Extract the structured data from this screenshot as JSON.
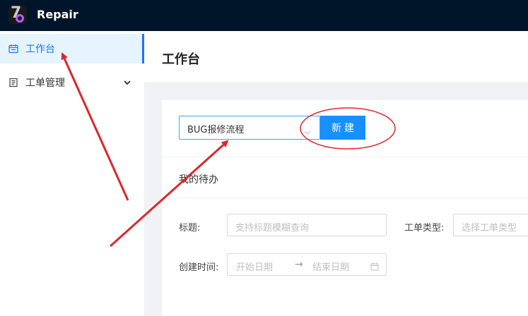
{
  "app": {
    "name": "Repair",
    "logo_icon": "app-logo-icon"
  },
  "sidebar": {
    "items": [
      {
        "label": "工作台",
        "icon": "calendar-icon",
        "active": true
      },
      {
        "label": "工单管理",
        "icon": "clipboard-icon",
        "expandable": true
      }
    ]
  },
  "header": {
    "title": "工作台"
  },
  "toolbar": {
    "process_select": {
      "value": "BUG报修流程"
    },
    "new_label": "新建"
  },
  "todo": {
    "title": "我的待办"
  },
  "filters": {
    "title_label": "标题:",
    "title_placeholder": "支持标题模糊查询",
    "type_label": "工单类型:",
    "type_placeholder": "选择工单类型",
    "time_label": "创建时间:",
    "start_placeholder": "开始日期",
    "range_separator": "→",
    "end_placeholder": "结束日期"
  },
  "colors": {
    "accent": "#1890ff",
    "header_bg": "#001529",
    "annotation": "#e0262d"
  }
}
